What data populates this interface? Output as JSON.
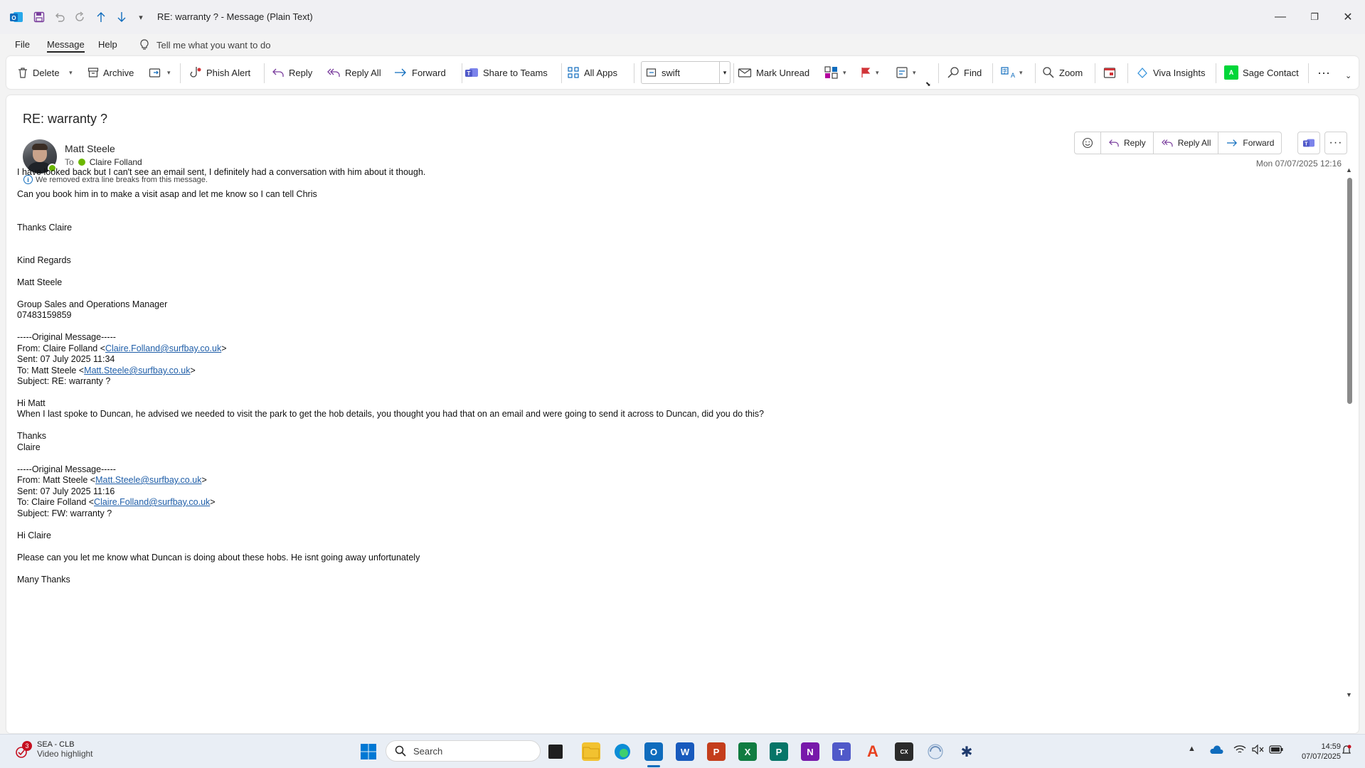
{
  "window": {
    "title": "RE: warranty ?  -  Message (Plain Text)"
  },
  "menu": {
    "tabs": [
      "File",
      "Message",
      "Help"
    ],
    "tell_me": "Tell me what you want to do"
  },
  "ribbon": {
    "delete": "Delete",
    "archive": "Archive",
    "phish_alert": "Phish Alert",
    "reply": "Reply",
    "reply_all": "Reply All",
    "forward": "Forward",
    "share_to_teams": "Share to Teams",
    "all_apps": "All Apps",
    "quick_step_value": "swift",
    "mark_unread": "Mark Unread",
    "find": "Find",
    "zoom": "Zoom",
    "viva_insights": "Viva Insights",
    "sage_contact": "Sage Contact"
  },
  "message": {
    "subject": "RE: warranty ?",
    "sender": "Matt Steele",
    "to_label": "To",
    "recipient": "Claire Folland",
    "info_notice": "We removed extra line breaks from this message.",
    "date": "Mon 07/07/2025 12:16",
    "actions": {
      "reply": "Reply",
      "reply_all": "Reply All",
      "forward": "Forward"
    },
    "body": {
      "l1": "I have looked back but I can't see an email sent, I definitely had a conversation with him about it though.",
      "l2": "Can you book him in to make a visit asap and let me know so I can tell Chris",
      "l3": "Thanks Claire",
      "l4": "Kind Regards",
      "l5": "Matt Steele",
      "l6": "Group Sales and Operations Manager",
      "l7": "07483159859",
      "orig1_header": "-----Original Message-----",
      "orig1_from_pre": "From: Claire Folland <",
      "orig1_from_link": "Claire.Folland@surfbay.co.uk",
      "orig1_sent": "Sent: 07 July 2025 11:34",
      "orig1_to_pre": "To: Matt Steele <",
      "orig1_to_link": "Matt.Steele@surfbay.co.uk",
      "orig1_subject": "Subject: RE: warranty ?",
      "orig1_greet": "Hi Matt",
      "orig1_text": "When I last spoke to Duncan, he advised we needed to visit the park to get the hob details, you thought you had that on an email and were going to send it across to Duncan, did you do this?",
      "orig1_thanks": "Thanks",
      "orig1_name": "Claire",
      "orig2_header": "-----Original Message-----",
      "orig2_from_pre": "From: Matt Steele <",
      "orig2_from_link": "Matt.Steele@surfbay.co.uk",
      "orig2_sent": "Sent: 07 July 2025 11:16",
      "orig2_to_pre": "To: Claire Folland <",
      "orig2_to_link": "Claire.Folland@surfbay.co.uk",
      "orig2_subject": "Subject: FW: warranty ?",
      "orig2_greet": "Hi Claire",
      "orig2_text": "Please can you let me know what Duncan is doing about these hobs. He isnt going away unfortunately",
      "orig2_thanks": "Many Thanks",
      "close_bracket": ">"
    }
  },
  "taskbar": {
    "weather_title": "SEA - CLB",
    "weather_sub": "Video highlight",
    "weather_badge": "3",
    "search_placeholder": "Search",
    "time": "14:59",
    "date": "07/07/2025"
  }
}
